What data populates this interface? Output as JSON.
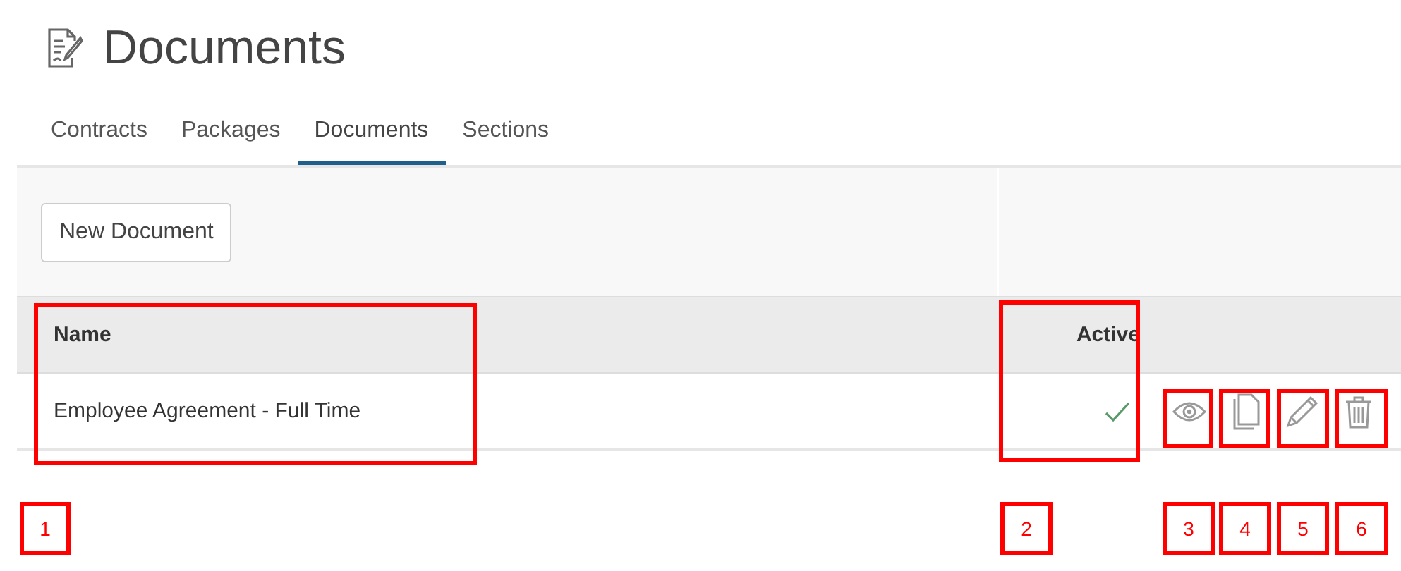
{
  "page": {
    "title": "Documents"
  },
  "tabs": [
    {
      "label": "Contracts",
      "selected": false
    },
    {
      "label": "Packages",
      "selected": false
    },
    {
      "label": "Documents",
      "selected": true
    },
    {
      "label": "Sections",
      "selected": false
    }
  ],
  "toolbar": {
    "button": "New Document"
  },
  "table": {
    "columns": [
      "Name",
      "Active"
    ],
    "rows": [
      {
        "name": "Employee Agreement - Full Time",
        "active": true,
        "actions": [
          {
            "kind": "view"
          },
          {
            "kind": "copy"
          },
          {
            "kind": "edit"
          },
          {
            "kind": "delete"
          }
        ]
      }
    ]
  },
  "annotations": [
    {
      "label": "1"
    },
    {
      "label": "2"
    },
    {
      "label": "3"
    },
    {
      "label": "4"
    },
    {
      "label": "5"
    },
    {
      "label": "6"
    }
  ]
}
